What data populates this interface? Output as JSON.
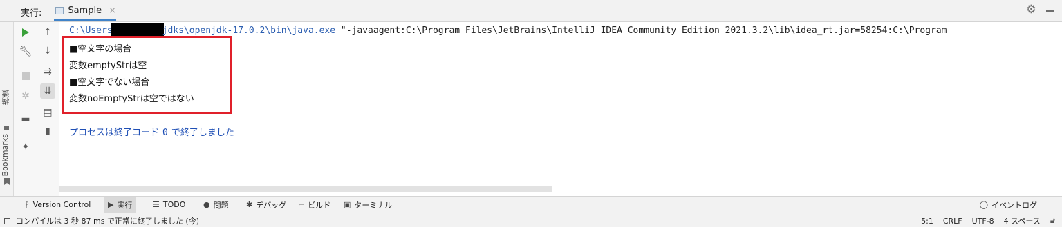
{
  "run_tab_bar": {
    "label": "実行:",
    "tab": {
      "label": "Sample",
      "close": "×"
    }
  },
  "left_strip": {
    "structure_label": "構造",
    "bookmarks_label": "Bookmarks"
  },
  "console": {
    "command_path_start": "C:\\Users",
    "command_path_end": "jdks\\openjdk-17.0.2\\bin\\java.exe",
    "command_rest": " \"-javaagent:C:\\Program Files\\JetBrains\\IntelliJ IDEA Community Edition 2021.3.2\\lib\\idea_rt.jar=58254:C:\\Program",
    "output_lines": [
      "■空文字の場合",
      "変数emptyStrは空",
      "■空文字でない場合",
      "変数noEmptyStrは空ではない"
    ],
    "exit_prefix": "プロセスは終了コード",
    "exit_code": "0",
    "exit_suffix": "で終了しました"
  },
  "bottom_tabs": [
    {
      "label": "Version Control",
      "icon": "branch-icon"
    },
    {
      "label": "実行",
      "icon": "run-icon",
      "active": true
    },
    {
      "label": "TODO",
      "icon": "list-icon"
    },
    {
      "label": "問題",
      "icon": "info-icon"
    },
    {
      "label": "デバッグ",
      "icon": "bug-icon"
    },
    {
      "label": "ビルド",
      "icon": "hammer-icon"
    },
    {
      "label": "ターミナル",
      "icon": "terminal-icon"
    }
  ],
  "event_log": "イベントログ",
  "status_bar": {
    "message": "コンパイルは 3 秒 87 ms で正常に終了しました (今)",
    "position": "5:1",
    "line_ending": "CRLF",
    "encoding": "UTF-8",
    "indent": "4 スペース"
  },
  "colors": {
    "highlight_border": "#e0202a",
    "link": "#2a5db0",
    "exit_text": "#1f4fb5",
    "run_green": "#3aa13a",
    "tab_underline": "#4083c9"
  }
}
